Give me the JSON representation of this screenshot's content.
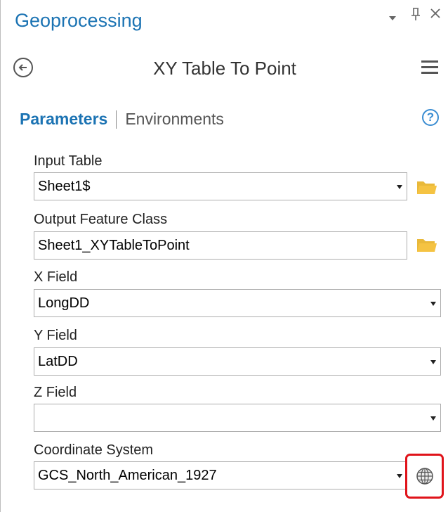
{
  "pane": {
    "title": "Geoprocessing",
    "controls": {
      "dropdown": "▾",
      "pin": "⊥",
      "close": "✕"
    }
  },
  "tool": {
    "title": "XY Table To Point"
  },
  "tabs": {
    "parameters": "Parameters",
    "environments": "Environments",
    "help": "?"
  },
  "params": {
    "input_table": {
      "label": "Input Table",
      "value": "Sheet1$"
    },
    "output_fc": {
      "label": "Output Feature Class",
      "value": "Sheet1_XYTableToPoint"
    },
    "x_field": {
      "label": "X Field",
      "value": "LongDD"
    },
    "y_field": {
      "label": "Y Field",
      "value": "LatDD"
    },
    "z_field": {
      "label": "Z Field",
      "value": ""
    },
    "coord_sys": {
      "label": "Coordinate System",
      "value": "GCS_North_American_1927"
    }
  },
  "colors": {
    "accent": "#1b73b3",
    "highlight": "#e0131a",
    "folder": "#f5c342"
  },
  "icons": [
    "back-arrow-icon",
    "hamburger-menu-icon",
    "help-icon",
    "folder-icon",
    "globe-icon",
    "dropdown-arrow-icon",
    "pin-icon",
    "close-icon"
  ]
}
